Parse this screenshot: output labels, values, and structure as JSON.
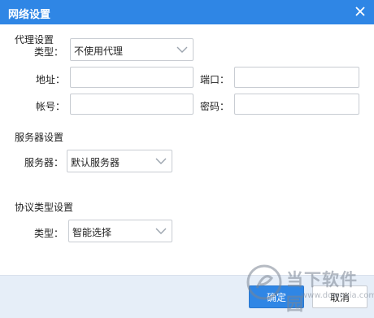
{
  "window": {
    "title": "网络设置"
  },
  "proxy": {
    "section_title": "代理设置",
    "type_label": "类型：",
    "type_value": "不使用代理",
    "address_label": "地址：",
    "address_value": "",
    "port_label": "端口：",
    "port_value": "",
    "account_label": "帐号：",
    "account_value": "",
    "password_label": "密码：",
    "password_value": ""
  },
  "server": {
    "section_title": "服务器设置",
    "label": "服务器：",
    "value": "默认服务器"
  },
  "protocol": {
    "section_title": "协议类型设置",
    "type_label": "类型：",
    "type_value": "智能选择"
  },
  "footer": {
    "ok_label": "确定",
    "cancel_label": "取消"
  },
  "watermark": {
    "text": "当下软件园",
    "url": "www.downxia.com"
  },
  "colors": {
    "titlebar": "#2f86e5",
    "footer_bg": "#e6eef8",
    "primary_button": "#2f86e5"
  }
}
